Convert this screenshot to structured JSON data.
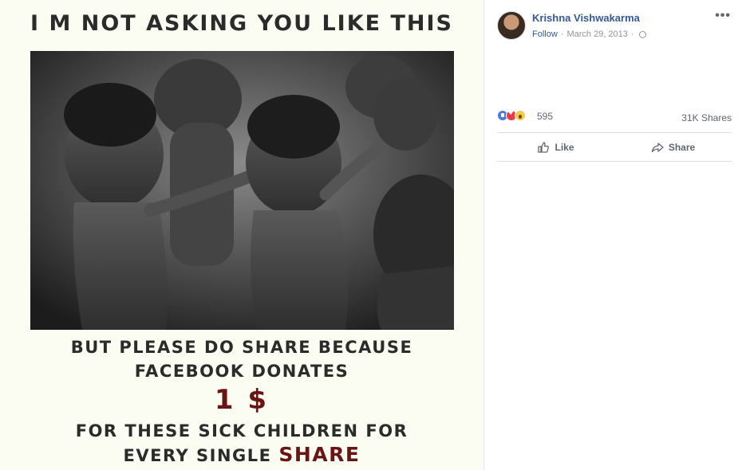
{
  "poster": {
    "headline": "I M NOT ASKING YOU LIKE THIS",
    "line1": "BUT PLEASE DO SHARE BECAUSE",
    "line2": "FACEBOOK DONATES",
    "amount": "1 $",
    "line3": "FOR THESE SICK CHILDREN FOR",
    "line4_prefix": "EVERY SINGLE",
    "line4_highlight": "SHARE",
    "highlight_color": "#6b1414"
  },
  "post": {
    "author": "Krishna Vishwakarma",
    "follow_label": "Follow",
    "separator": "·",
    "date": "March 29, 2013",
    "privacy_icon": "globe-icon",
    "more_icon": "•••"
  },
  "engagement": {
    "reaction_icons": [
      "like-reaction-icon",
      "love-reaction-icon",
      "wow-reaction-icon"
    ],
    "reaction_count": "595",
    "shares": "31K Shares"
  },
  "actions": {
    "like_label": "Like",
    "share_label": "Share"
  },
  "colors": {
    "link_blue": "#365899",
    "muted_gray": "#606770",
    "poster_bg": "#fbfcf2"
  }
}
